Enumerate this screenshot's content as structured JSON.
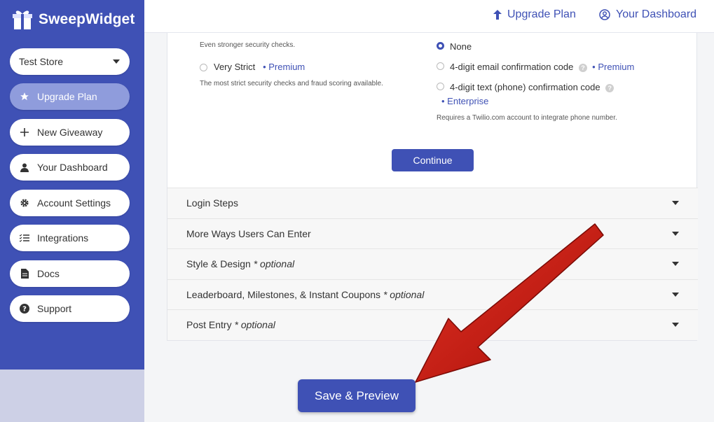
{
  "brand": {
    "name": "SweepWidget"
  },
  "sidebar": {
    "store_select": "Test Store",
    "items": [
      {
        "label": "Upgrade Plan",
        "icon": "star-icon"
      },
      {
        "label": "New Giveaway",
        "icon": "plus-icon"
      },
      {
        "label": "Your Dashboard",
        "icon": "user-icon"
      },
      {
        "label": "Account Settings",
        "icon": "gear-icon"
      },
      {
        "label": "Integrations",
        "icon": "checklist-icon"
      },
      {
        "label": "Docs",
        "icon": "document-icon"
      },
      {
        "label": "Support",
        "icon": "question-icon"
      }
    ]
  },
  "topbar": {
    "upgrade": "Upgrade Plan",
    "dashboard": "Your Dashboard"
  },
  "security": {
    "stronger_desc": "Even stronger security checks.",
    "very_strict_label": "Very Strict",
    "very_strict_tier": "• Premium",
    "very_strict_desc": "The most strict security checks and fraud scoring available."
  },
  "confirmation": {
    "none": "None",
    "email": "4-digit email confirmation code",
    "email_tier": "• Premium",
    "text": "4-digit text (phone) confirmation code",
    "text_tier": "• Enterprise",
    "text_note": "Requires a Twilio.com account to integrate phone number."
  },
  "continue_label": "Continue",
  "sections": [
    {
      "title": "Login Steps",
      "optional": ""
    },
    {
      "title": "More Ways Users Can Enter",
      "optional": ""
    },
    {
      "title": "Style & Design",
      "optional": "* optional"
    },
    {
      "title": "Leaderboard, Milestones, & Instant Coupons",
      "optional": "* optional"
    },
    {
      "title": "Post Entry",
      "optional": "* optional"
    }
  ],
  "save_label": "Save & Preview",
  "colors": {
    "primary": "#3f51b5",
    "arrow": "#c0160e",
    "active_nav": "#8f9cdc"
  }
}
